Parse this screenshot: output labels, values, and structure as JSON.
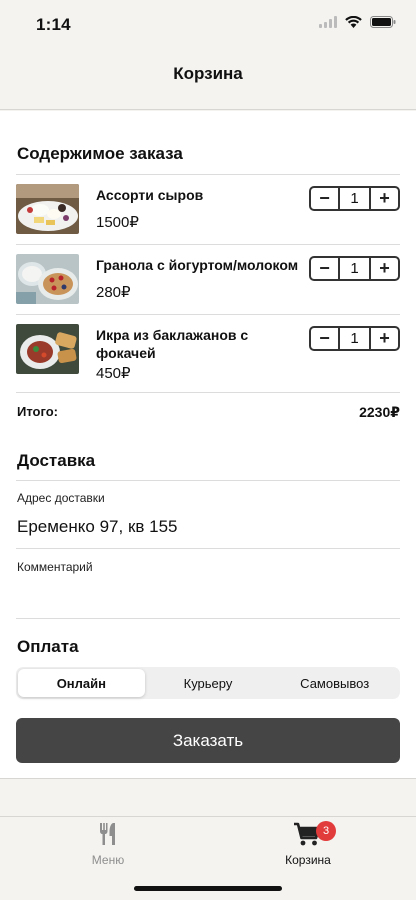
{
  "status": {
    "time": "1:14"
  },
  "nav": {
    "title": "Корзина"
  },
  "order": {
    "title": "Содержимое заказа",
    "items": [
      {
        "name": "Ассорти сыров",
        "price": "1500₽",
        "qty": "1",
        "thumb_icon": "cheese-plate-photo"
      },
      {
        "name": "Гранола с йогуртом/молоком",
        "price": "280₽",
        "qty": "1",
        "thumb_icon": "granola-photo"
      },
      {
        "name": "Икра из баклажанов с фокачей",
        "price": "450₽",
        "qty": "1",
        "thumb_icon": "eggplant-caviar-photo"
      }
    ],
    "minus_symbol": "−",
    "plus_symbol": "+",
    "total_label": "Итого:",
    "total_value": "2230₽"
  },
  "delivery": {
    "title": "Доставка",
    "address_label": "Адрес доставки",
    "address_value": "Еременко 97, кв 155",
    "comment_label": "Комментарий",
    "comment_value": ""
  },
  "payment": {
    "title": "Оплата",
    "options": [
      "Онлайн",
      "Курьеру",
      "Самовывоз"
    ],
    "selected": "Онлайн"
  },
  "order_button": {
    "label": "Заказать"
  },
  "tabbar": {
    "menu_label": "Меню",
    "cart_label": "Корзина",
    "cart_badge": "3",
    "menu_icon": "fork-knife-icon",
    "cart_icon": "cart-icon"
  },
  "colors": {
    "background": "#f4f3f0",
    "button": "#454545",
    "badge": "#e23b3b"
  }
}
